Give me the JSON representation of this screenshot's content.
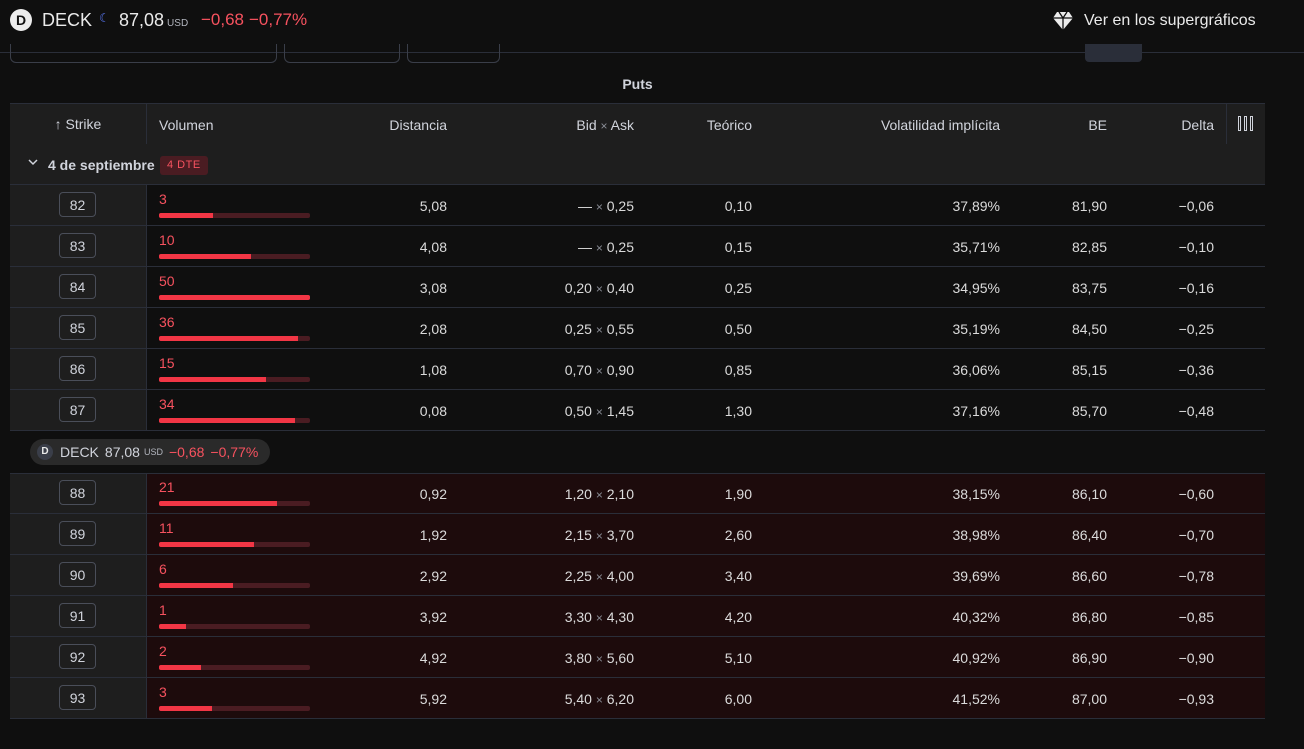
{
  "header": {
    "logo_letter": "D",
    "symbol": "DECK",
    "status_icon": "moon-icon",
    "price": "87,08",
    "currency": "USD",
    "change": "−0,68",
    "change_pct": "−0,77%",
    "supercharts_label": "Ver en los supergráficos",
    "supercharts_icon": "diamond-icon"
  },
  "section_title": "Puts",
  "columns": {
    "strike": "Strike",
    "sort_icon": "arrow-up-icon",
    "volume": "Volumen",
    "distance": "Distancia",
    "bid": "Bid",
    "x": "×",
    "ask": "Ask",
    "theoretical": "Teórico",
    "iv": "Volatilidad implícita",
    "be": "BE",
    "delta": "Delta",
    "columns_icon": "columns-icon"
  },
  "group": {
    "date": "4 de septiembre",
    "dte": "4 DTE",
    "chevron_icon": "chevron-down-icon"
  },
  "price_marker": {
    "symbol": "DECK",
    "price": "87,08",
    "currency": "USD",
    "change": "−0,68",
    "change_pct": "−0,77%"
  },
  "rows": [
    {
      "strike": "82",
      "volume": "3",
      "vol_fill": 0.36,
      "distance": "5,08",
      "bid": "—",
      "ask": "0,25",
      "theoretical": "0,10",
      "iv": "37,89%",
      "be": "81,90",
      "delta": "−0,06"
    },
    {
      "strike": "83",
      "volume": "10",
      "vol_fill": 0.61,
      "distance": "4,08",
      "bid": "—",
      "ask": "0,25",
      "theoretical": "0,15",
      "iv": "35,71%",
      "be": "82,85",
      "delta": "−0,10"
    },
    {
      "strike": "84",
      "volume": "50",
      "vol_fill": 1.0,
      "distance": "3,08",
      "bid": "0,20",
      "ask": "0,40",
      "theoretical": "0,25",
      "iv": "34,95%",
      "be": "83,75",
      "delta": "−0,16"
    },
    {
      "strike": "85",
      "volume": "36",
      "vol_fill": 0.92,
      "distance": "2,08",
      "bid": "0,25",
      "ask": "0,55",
      "theoretical": "0,50",
      "iv": "35,19%",
      "be": "84,50",
      "delta": "−0,25"
    },
    {
      "strike": "86",
      "volume": "15",
      "vol_fill": 0.71,
      "distance": "1,08",
      "bid": "0,70",
      "ask": "0,90",
      "theoretical": "0,85",
      "iv": "36,06%",
      "be": "85,15",
      "delta": "−0,36"
    },
    {
      "strike": "87",
      "volume": "34",
      "vol_fill": 0.9,
      "distance": "0,08",
      "bid": "0,50",
      "ask": "1,45",
      "theoretical": "1,30",
      "iv": "37,16%",
      "be": "85,70",
      "delta": "−0,48"
    },
    {
      "strike": "88",
      "volume": "21",
      "vol_fill": 0.78,
      "distance": "0,92",
      "bid": "1,20",
      "ask": "2,10",
      "theoretical": "1,90",
      "iv": "38,15%",
      "be": "86,10",
      "delta": "−0,60"
    },
    {
      "strike": "89",
      "volume": "11",
      "vol_fill": 0.63,
      "distance": "1,92",
      "bid": "2,15",
      "ask": "3,70",
      "theoretical": "2,60",
      "iv": "38,98%",
      "be": "86,40",
      "delta": "−0,70"
    },
    {
      "strike": "90",
      "volume": "6",
      "vol_fill": 0.49,
      "distance": "2,92",
      "bid": "2,25",
      "ask": "4,00",
      "theoretical": "3,40",
      "iv": "39,69%",
      "be": "86,60",
      "delta": "−0,78"
    },
    {
      "strike": "91",
      "volume": "1",
      "vol_fill": 0.18,
      "distance": "3,92",
      "bid": "3,30",
      "ask": "4,30",
      "theoretical": "4,20",
      "iv": "40,32%",
      "be": "86,80",
      "delta": "−0,85"
    },
    {
      "strike": "92",
      "volume": "2",
      "vol_fill": 0.28,
      "distance": "4,92",
      "bid": "3,80",
      "ask": "5,60",
      "theoretical": "5,10",
      "iv": "40,92%",
      "be": "86,90",
      "delta": "−0,90"
    },
    {
      "strike": "93",
      "volume": "3",
      "vol_fill": 0.35,
      "distance": "5,92",
      "bid": "5,40",
      "ask": "6,20",
      "theoretical": "6,00",
      "iv": "41,52%",
      "be": "87,00",
      "delta": "−0,93"
    }
  ]
}
